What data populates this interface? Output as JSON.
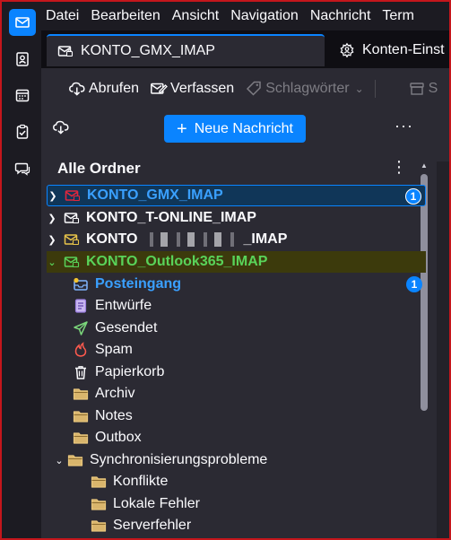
{
  "menubar": {
    "items": [
      "Datei",
      "Bearbeiten",
      "Ansicht",
      "Navigation",
      "Nachricht",
      "Term"
    ]
  },
  "tabs": [
    {
      "label": "KONTO_GMX_IMAP",
      "icon": "mail-folder-icon"
    },
    {
      "label": "Konten-Einst",
      "icon": "account-settings-icon"
    }
  ],
  "toolbar": {
    "get_messages": "Abrufen",
    "compose": "Verfassen",
    "tags": "Schlagwörter",
    "archive": "S"
  },
  "folder_pane": {
    "new_message": "Neue Nachricht",
    "section_title": "Alle Ordner",
    "accounts": [
      {
        "label": "KONTO_GMX_IMAP",
        "badge": "1"
      },
      {
        "label": "KONTO_T-ONLINE_IMAP"
      },
      {
        "label_prefix": "KONTO",
        "label_suffix": "_IMAP"
      },
      {
        "label": "KONTO_Outlook365_IMAP"
      }
    ],
    "folders": [
      {
        "label": "Posteingang",
        "badge": "1",
        "icon": "inbox-icon"
      },
      {
        "label": "Entwürfe",
        "icon": "drafts-icon"
      },
      {
        "label": "Gesendet",
        "icon": "sent-icon"
      },
      {
        "label": "Spam",
        "icon": "spam-icon"
      },
      {
        "label": "Papierkorb",
        "icon": "trash-icon"
      },
      {
        "label": "Archiv",
        "icon": "folder-icon"
      },
      {
        "label": "Notes",
        "icon": "folder-icon"
      },
      {
        "label": "Outbox",
        "icon": "folder-icon"
      },
      {
        "label": "Synchronisierungsprobleme",
        "icon": "folder-icon"
      },
      {
        "label": "Konflikte",
        "icon": "folder-icon"
      },
      {
        "label": "Lokale Fehler",
        "icon": "folder-icon"
      },
      {
        "label": "Serverfehler",
        "icon": "folder-icon"
      }
    ]
  },
  "colors": {
    "accent": "#0a84ff",
    "selected_account_text": "#3aa0ff",
    "outlook_account_text": "#59d359",
    "inbox_text": "#3aa0ff"
  }
}
